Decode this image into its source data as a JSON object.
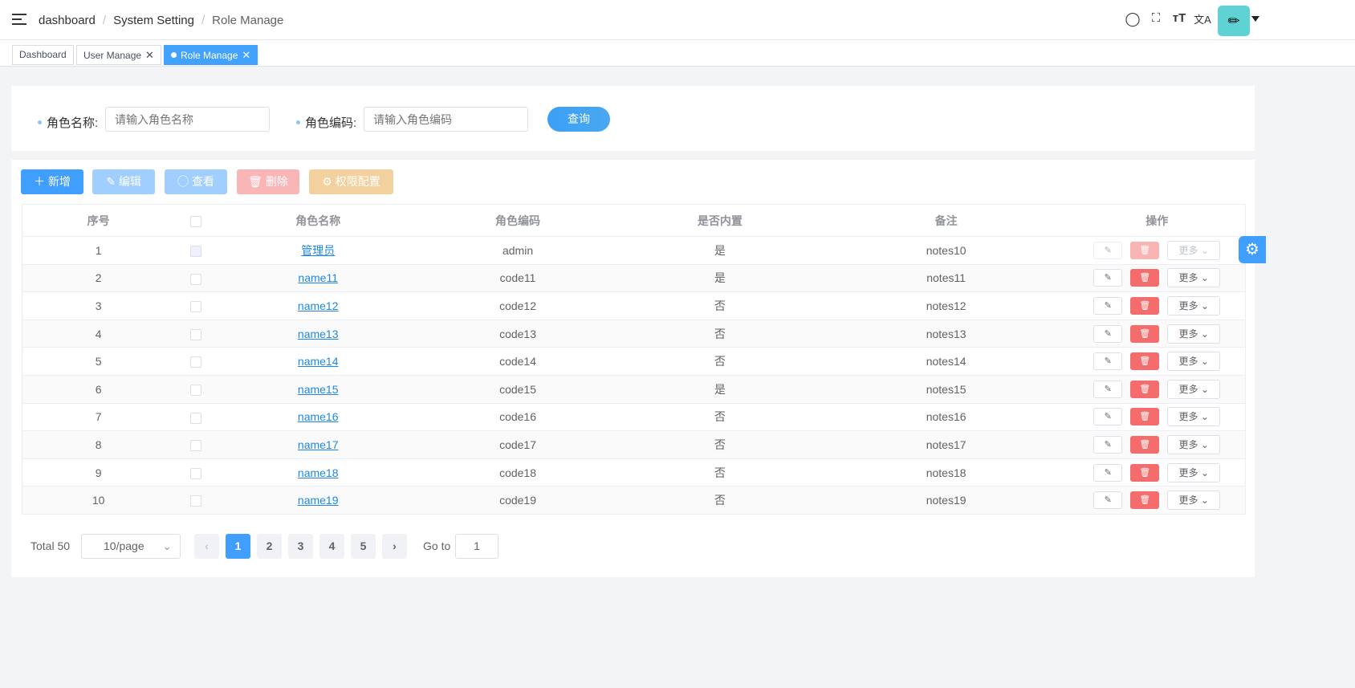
{
  "header": {
    "breadcrumb": [
      "dashboard",
      "System Setting",
      "Role Manage"
    ],
    "icons": [
      "search-icon",
      "fullscreen-icon",
      "font-size-icon",
      "translate-icon"
    ]
  },
  "tabs": [
    {
      "label": "Dashboard"
    },
    {
      "label": "User Manage",
      "close": "✕"
    },
    {
      "label": "Role Manage",
      "close": "✕",
      "active": true
    }
  ],
  "search": {
    "name_label": "角色名称:",
    "name_placeholder": "请输入角色名称",
    "code_label": "角色编码:",
    "code_placeholder": "请输入角色编码",
    "query": "查询"
  },
  "toolbar": {
    "add": "新增",
    "edit": "编辑",
    "view": "查看",
    "delete": "删除",
    "perm": "权限配置"
  },
  "table": {
    "headers": [
      "序号",
      "",
      "角色名称",
      "角色编码",
      "是否内置",
      "备注",
      "操作"
    ],
    "more_label": "更多",
    "rows": [
      [
        "1",
        "管理员",
        "admin",
        "是",
        "notes10"
      ],
      [
        "2",
        "name11",
        "code11",
        "是",
        "notes11"
      ],
      [
        "3",
        "name12",
        "code12",
        "否",
        "notes12"
      ],
      [
        "4",
        "name13",
        "code13",
        "否",
        "notes13"
      ],
      [
        "5",
        "name14",
        "code14",
        "否",
        "notes14"
      ],
      [
        "6",
        "name15",
        "code15",
        "是",
        "notes15"
      ],
      [
        "7",
        "name16",
        "code16",
        "否",
        "notes16"
      ],
      [
        "8",
        "name17",
        "code17",
        "否",
        "notes17"
      ],
      [
        "9",
        "name18",
        "code18",
        "否",
        "notes18"
      ],
      [
        "10",
        "name19",
        "code19",
        "否",
        "notes19"
      ]
    ]
  },
  "pagination": {
    "total": "Total 50",
    "page_size": "10/page",
    "pages": [
      "1",
      "2",
      "3",
      "4",
      "5"
    ],
    "current": "1",
    "goto_label": "Go to",
    "goto_value": "1"
  },
  "colors": {
    "primary": "#409eff",
    "danger": "#f56c6c",
    "warning": "#f0d29c"
  }
}
